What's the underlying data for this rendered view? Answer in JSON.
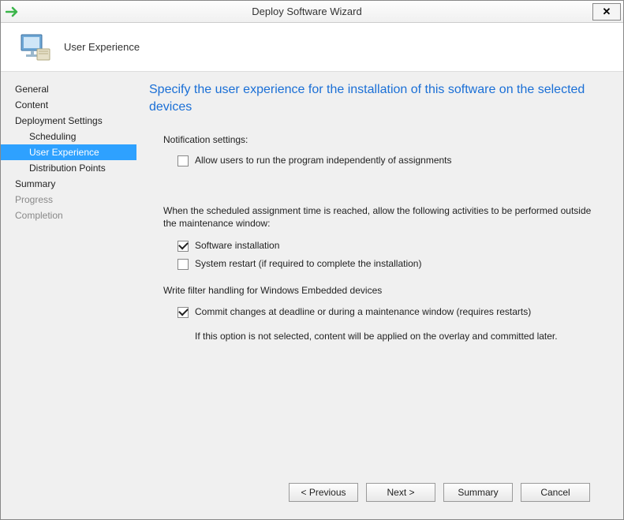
{
  "titlebar": {
    "title": "Deploy Software Wizard",
    "close": "✕"
  },
  "header": {
    "page_title": "User Experience"
  },
  "sidebar": {
    "items": [
      {
        "label": "General",
        "child": false,
        "dim": false,
        "selected": false
      },
      {
        "label": "Content",
        "child": false,
        "dim": false,
        "selected": false
      },
      {
        "label": "Deployment Settings",
        "child": false,
        "dim": false,
        "selected": false
      },
      {
        "label": "Scheduling",
        "child": true,
        "dim": false,
        "selected": false
      },
      {
        "label": "User Experience",
        "child": true,
        "dim": false,
        "selected": true
      },
      {
        "label": "Distribution Points",
        "child": true,
        "dim": false,
        "selected": false
      },
      {
        "label": "Summary",
        "child": false,
        "dim": false,
        "selected": false
      },
      {
        "label": "Progress",
        "child": false,
        "dim": true,
        "selected": false
      },
      {
        "label": "Completion",
        "child": false,
        "dim": true,
        "selected": false
      }
    ]
  },
  "content": {
    "heading": "Specify the user experience for the installation of this software on the selected devices",
    "notification_label": "Notification settings:",
    "cb_allow_users": {
      "label": "Allow users to run the program independently of assignments",
      "checked": false
    },
    "maintenance_text": "When the scheduled assignment time is reached, allow the following activities to be performed outside the maintenance window:",
    "cb_software_install": {
      "label": "Software installation",
      "checked": true
    },
    "cb_system_restart": {
      "label": "System restart (if required to complete the installation)",
      "checked": false
    },
    "write_filter_label": "Write filter handling for Windows Embedded devices",
    "cb_commit_changes": {
      "label": "Commit changes at deadline or during a maintenance window (requires restarts)",
      "checked": true
    },
    "commit_note": "If this option is not selected, content will be applied on the overlay and committed later."
  },
  "footer": {
    "previous": "< Previous",
    "next": "Next >",
    "summary": "Summary",
    "cancel": "Cancel"
  }
}
